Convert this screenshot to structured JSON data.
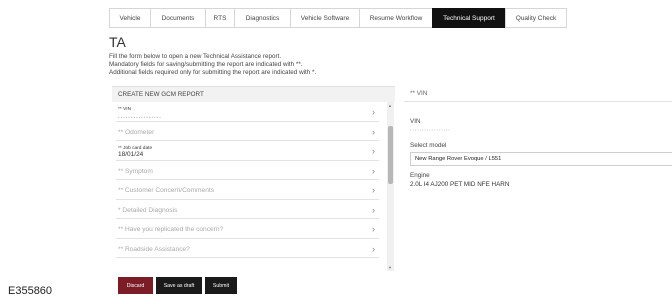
{
  "tabs": [
    "Vehicle",
    "Documents",
    "RTS",
    "Diagnostics",
    "Vehicle Software",
    "Resume Workflow",
    "Technical Support",
    "Quality Check"
  ],
  "active_tab_index": 6,
  "page": {
    "title": "TA",
    "intro": [
      "Fill the form below to open a new Technical Assistance report.",
      "Mandatory fields for saving/submitting the report are indicated with **.",
      "Additional fields required only for submitting the report are indicated with *."
    ]
  },
  "form": {
    "header": "CREATE NEW GCM REPORT",
    "rows": [
      {
        "label": "** VIN",
        "value": "•••••••••••••••••"
      },
      {
        "label": "** Odometer",
        "value": ""
      },
      {
        "label": "** Job card date",
        "value": "18/01/24"
      },
      {
        "label": "** Symptom",
        "value": ""
      },
      {
        "label": "** Customer Concern/Comments",
        "value": ""
      },
      {
        "label": "* Detailed Diagnosis",
        "value": ""
      },
      {
        "label": "** Have you replicated the concern?",
        "value": ""
      },
      {
        "label": "** Roadside Assistance?",
        "value": ""
      }
    ]
  },
  "actions": {
    "discard": "Discard",
    "save_draft": "Save as draft",
    "submit": "Submit"
  },
  "details": {
    "header": "** VIN",
    "vin_label": "VIN",
    "vin_value": "•••••••••••••••••",
    "model_label": "Select model",
    "model_value": "New Range Rover Evoque / L551",
    "engine_label": "Engine",
    "engine_value": "2.0L I4 AJ200 PET MID NFE HARN"
  },
  "figure_id": "E355860",
  "colors": {
    "active_tab": "#111111",
    "discard": "#7b1c27",
    "button": "#1a1a1a"
  }
}
